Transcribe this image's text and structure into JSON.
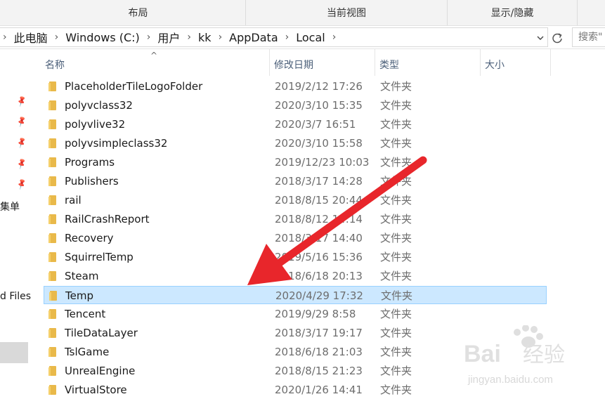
{
  "ribbon": {
    "groups": [
      {
        "label": "布局"
      },
      {
        "label": "当前视图"
      },
      {
        "label": "显示/隐藏"
      }
    ]
  },
  "address": {
    "crumbs": [
      "此电脑",
      "Windows (C:)",
      "用户",
      "kk",
      "AppData",
      "Local"
    ],
    "separator": "›",
    "dropdown_icon": "chevron-down-icon",
    "refresh_icon": "refresh-icon",
    "search_placeholder": "搜索\""
  },
  "nav": {
    "pinned_count": 5,
    "items": [
      {
        "label": "集单"
      },
      {
        "label": "d Files"
      }
    ]
  },
  "columns": {
    "name": "名称",
    "date": "修改日期",
    "type": "类型",
    "size": "大小",
    "sort_indicator": "^"
  },
  "files": [
    {
      "name": "PlaceholderTileLogoFolder",
      "date": "2019/2/12 17:26",
      "type": "文件夹"
    },
    {
      "name": "polyvclass32",
      "date": "2020/3/10 15:35",
      "type": "文件夹"
    },
    {
      "name": "polyvlive32",
      "date": "2020/3/7 16:51",
      "type": "文件夹"
    },
    {
      "name": "polyvsimpleclass32",
      "date": "2020/3/10 15:58",
      "type": "文件夹"
    },
    {
      "name": "Programs",
      "date": "2019/12/23 10:03",
      "type": "文件夹"
    },
    {
      "name": "Publishers",
      "date": "2018/3/17 14:28",
      "type": "文件夹"
    },
    {
      "name": "rail",
      "date": "2018/8/15 20:44",
      "type": "文件夹"
    },
    {
      "name": "RailCrashReport",
      "date": "2018/8/12 14:14",
      "type": "文件夹"
    },
    {
      "name": "Recovery",
      "date": "2018/3/17 14:40",
      "type": "文件夹"
    },
    {
      "name": "SquirrelTemp",
      "date": "2019/5/16 15:36",
      "type": "文件夹"
    },
    {
      "name": "Steam",
      "date": "2018/6/18 20:13",
      "type": "文件夹"
    },
    {
      "name": "Temp",
      "date": "2020/4/29 17:32",
      "type": "文件夹",
      "selected": true
    },
    {
      "name": "Tencent",
      "date": "2019/9/29 8:58",
      "type": "文件夹"
    },
    {
      "name": "TileDataLayer",
      "date": "2018/3/17 19:17",
      "type": "文件夹"
    },
    {
      "name": "TslGame",
      "date": "2018/6/18 21:03",
      "type": "文件夹"
    },
    {
      "name": "UnrealEngine",
      "date": "2018/8/15 21:23",
      "type": "文件夹"
    },
    {
      "name": "VirtualStore",
      "date": "2020/1/26 14:41",
      "type": "文件夹"
    }
  ],
  "colors": {
    "selection_bg": "#cce8ff",
    "selection_border": "#99d1ff",
    "folder": "#e9b94a",
    "annotation_arrow": "#e8262b"
  },
  "watermark": {
    "brand": "Bai",
    "brand_cn": "经验",
    "url": "jingyan.baidu.com"
  }
}
